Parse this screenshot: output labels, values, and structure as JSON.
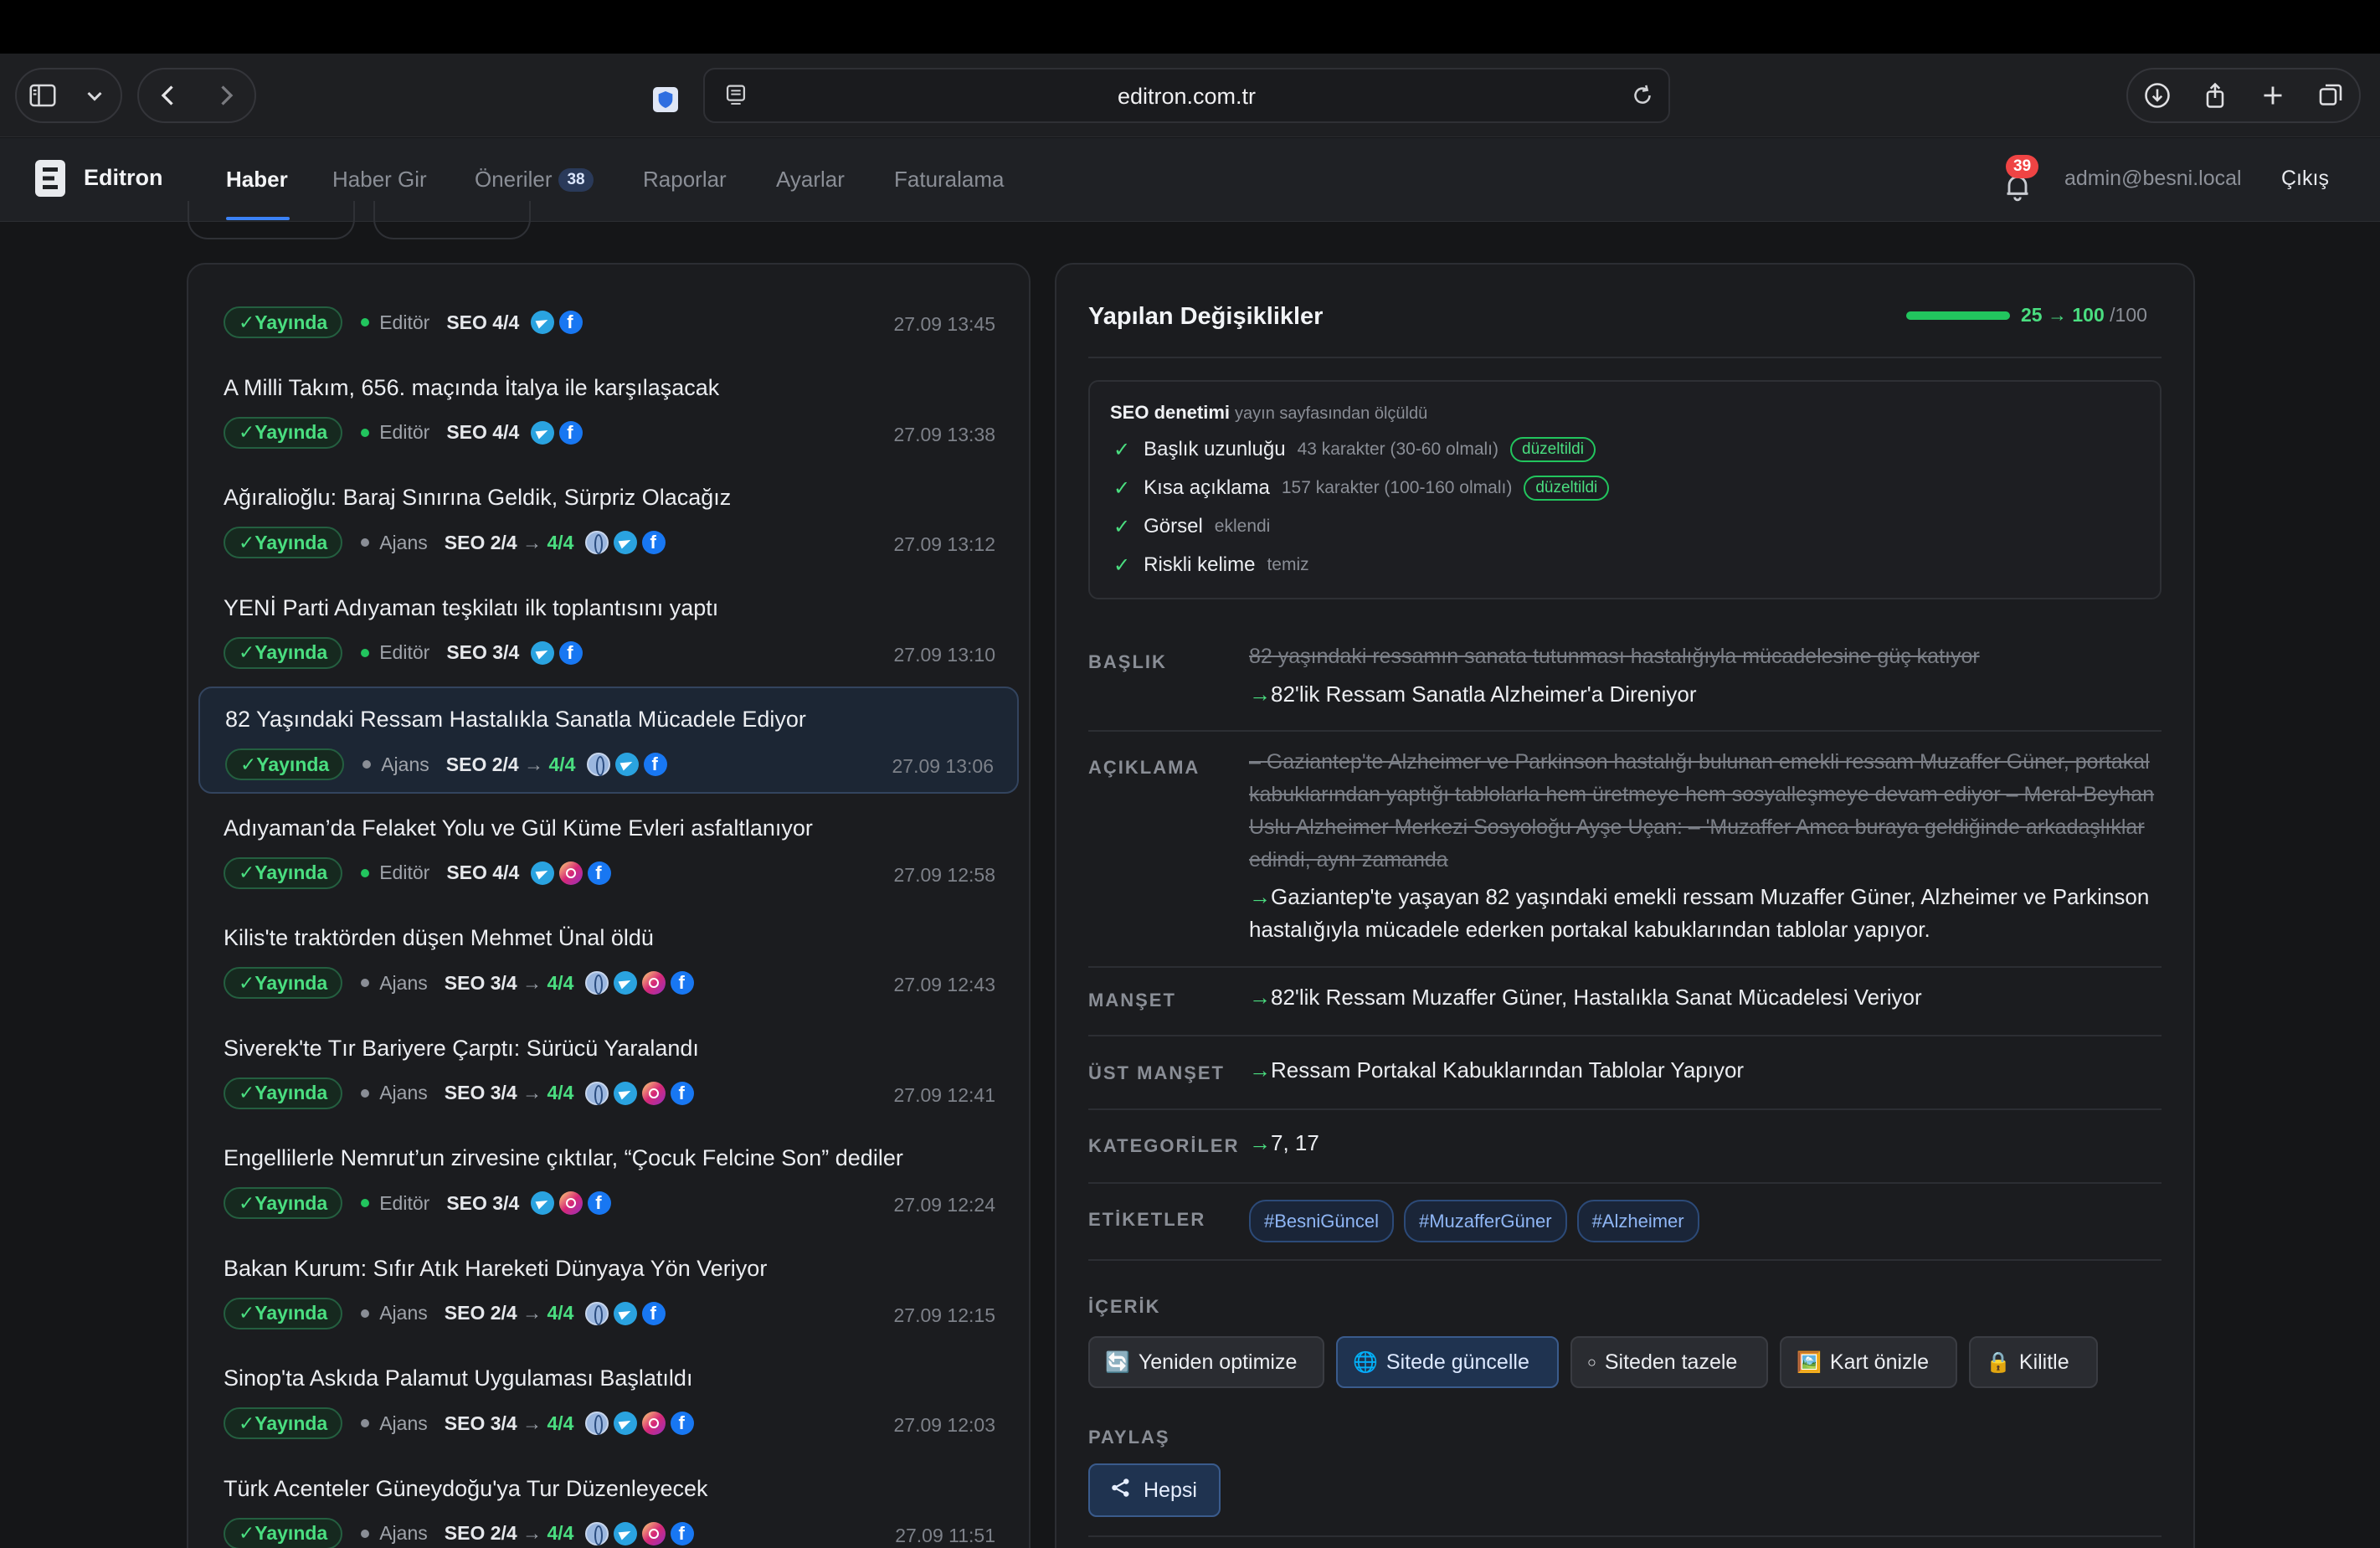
{
  "browser": {
    "url": "editron.com.tr"
  },
  "app": {
    "brand": "Editron",
    "nav": [
      {
        "label": "Haber",
        "badge": null
      },
      {
        "label": "Haber Gir",
        "badge": null
      },
      {
        "label": "Öneriler",
        "badge": "38"
      },
      {
        "label": "Raporlar",
        "badge": null
      },
      {
        "label": "Ayarlar",
        "badge": null
      },
      {
        "label": "Faturalama",
        "badge": null
      }
    ],
    "notification_count": "39",
    "user_email": "admin@besni.local",
    "logout": "Çıkış"
  },
  "news": [
    {
      "title": "",
      "status": "✓Yayında",
      "source": "Editör",
      "source_color": "green",
      "seo_from": "",
      "seo_to": "SEO 4/4",
      "icons": [
        "tg",
        "fb"
      ],
      "time": "27.09 13:45"
    },
    {
      "title": "A Milli Takım, 656. maçında İtalya ile karşılaşacak",
      "status": "✓Yayında",
      "source": "Editör",
      "source_color": "green",
      "seo_from": "",
      "seo_to": "SEO 4/4",
      "icons": [
        "tg",
        "fb"
      ],
      "time": "27.09 13:38"
    },
    {
      "title": "Ağıralioğlu: Baraj Sınırına Geldik, Sürpriz Olacağız",
      "status": "✓Yayında",
      "source": "Ajans",
      "source_color": "gray",
      "seo_from": "SEO 2/4",
      "seo_to": "4/4",
      "icons": [
        "web",
        "tg",
        "fb"
      ],
      "time": "27.09 13:12"
    },
    {
      "title": "YENİ Parti Adıyaman teşkilatı ilk toplantısını yaptı",
      "status": "✓Yayında",
      "source": "Editör",
      "source_color": "green",
      "seo_from": "",
      "seo_to": "SEO 3/4",
      "icons": [
        "tg",
        "fb"
      ],
      "time": "27.09 13:10"
    },
    {
      "title": "82 Yaşındaki Ressam Hastalıkla Sanatla Mücadele Ediyor",
      "status": "✓Yayında",
      "source": "Ajans",
      "source_color": "gray",
      "seo_from": "SEO 2/4",
      "seo_to": "4/4",
      "icons": [
        "web",
        "tg",
        "fb"
      ],
      "time": "27.09 13:06",
      "selected": true
    },
    {
      "title": "Adıyaman’da Felaket Yolu ve Gül Küme Evleri asfaltlanıyor",
      "status": "✓Yayında",
      "source": "Editör",
      "source_color": "green",
      "seo_from": "",
      "seo_to": "SEO 4/4",
      "icons": [
        "tg",
        "ig",
        "fb"
      ],
      "time": "27.09 12:58"
    },
    {
      "title": "Kilis'te traktörden düşen Mehmet Ünal öldü",
      "status": "✓Yayında",
      "source": "Ajans",
      "source_color": "gray",
      "seo_from": "SEO 3/4",
      "seo_to": "4/4",
      "icons": [
        "web",
        "tg",
        "ig",
        "fb"
      ],
      "time": "27.09 12:43"
    },
    {
      "title": "Siverek'te Tır Bariyere Çarptı: Sürücü Yaralandı",
      "status": "✓Yayında",
      "source": "Ajans",
      "source_color": "gray",
      "seo_from": "SEO 3/4",
      "seo_to": "4/4",
      "icons": [
        "web",
        "tg",
        "ig",
        "fb"
      ],
      "time": "27.09 12:41"
    },
    {
      "title": "Engellilerle Nemrut’un zirvesine çıktılar, “Çocuk Felcine Son” dediler",
      "status": "✓Yayında",
      "source": "Editör",
      "source_color": "green",
      "seo_from": "",
      "seo_to": "SEO 3/4",
      "icons": [
        "tg",
        "ig",
        "fb"
      ],
      "time": "27.09 12:24"
    },
    {
      "title": "Bakan Kurum: Sıfır Atık Hareketi Dünyaya Yön Veriyor",
      "status": "✓Yayında",
      "source": "Ajans",
      "source_color": "gray",
      "seo_from": "SEO 2/4",
      "seo_to": "4/4",
      "icons": [
        "web",
        "tg",
        "fb"
      ],
      "time": "27.09 12:15"
    },
    {
      "title": "Sinop'ta Askıda Palamut Uygulaması Başlatıldı",
      "status": "✓Yayında",
      "source": "Ajans",
      "source_color": "gray",
      "seo_from": "SEO 3/4",
      "seo_to": "4/4",
      "icons": [
        "web",
        "tg",
        "ig",
        "fb"
      ],
      "time": "27.09 12:03"
    },
    {
      "title": "Türk Acenteler Güneydoğu'ya Tur Düzenleyecek",
      "status": "✓Yayında",
      "source": "Ajans",
      "source_color": "gray",
      "seo_from": "SEO 2/4",
      "seo_to": "4/4",
      "icons": [
        "web",
        "tg",
        "ig",
        "fb"
      ],
      "time": "27.09 11:51"
    }
  ],
  "changes": {
    "title": "Yapılan Değişiklikler",
    "score_from": "25",
    "score_to": "100",
    "score_max": "/100",
    "score_fraction": 1.0,
    "seo_audit": {
      "heading": "SEO denetimi",
      "subheading": "yayın sayfasından ölçüldü",
      "checks": [
        {
          "label": "Başlık uzunluğu",
          "detail": "43 karakter (30-60 olmalı)",
          "badge": "düzeltildi"
        },
        {
          "label": "Kısa açıklama",
          "detail": "157 karakter (100-160 olmalı)",
          "badge": "düzeltildi"
        },
        {
          "label": "Görsel",
          "detail": "eklendi",
          "badge": ""
        },
        {
          "label": "Riskli kelime",
          "detail": "temiz",
          "badge": ""
        }
      ]
    },
    "fields": {
      "baslik_label": "BAŞLIK",
      "baslik_old": "82 yaşındaki ressamın sanata tutunması hastalığıyla mücadelesine güç katıyor",
      "baslik_new": "82'lik Ressam Sanatla Alzheimer'a Direniyor",
      "aciklama_label": "AÇIKLAMA",
      "aciklama_old": "– Gaziantep'te Alzheimer ve Parkinson hastalığı bulunan emekli ressam Muzaffer Güner, portakal kabuklarından yaptığı tablolarla hem üretmeye hem sosyalleşmeye devam ediyor – Meral-Beyhan Uslu Alzheimer Merkezi Sosyoloğu Ayşe Uçan: – 'Muzaffer Amca buraya geldiğinde arkadaşlıklar edindi, aynı zamanda",
      "aciklama_new": "Gaziantep'te yaşayan 82 yaşındaki emekli ressam Muzaffer Güner, Alzheimer ve Parkinson hastalığıyla mücadele ederken portakal kabuklarından tablolar yapıyor.",
      "manset_label": "MANŞET",
      "manset_new": "82'lik Ressam Muzaffer Güner, Hastalıkla Sanat Mücadelesi Veriyor",
      "ust_manset_label": "ÜST MANŞET",
      "ust_manset_new": "Ressam Portakal Kabuklarından Tablolar Yapıyor",
      "kategoriler_label": "KATEGORİLER",
      "kategoriler_new": "7, 17",
      "etiketler_label": "ETİKETLER",
      "etiketler": [
        "#BesniGüncel",
        "#MuzafferGüner",
        "#Alzheimer"
      ],
      "icerik_label": "İÇERİK",
      "paylas_label": "PAYLAŞ"
    },
    "actions": {
      "reoptimize": "Yeniden optimize",
      "update_site": "Sitede güncelle",
      "refresh_site": "Siteden tazele",
      "card_preview": "Kart önizle",
      "lock": "Kilitle"
    },
    "share_all": "Hepsi"
  },
  "colors": {
    "accent": "#3b82f6",
    "success": "#22c55e",
    "badge_red": "#ef4444"
  }
}
